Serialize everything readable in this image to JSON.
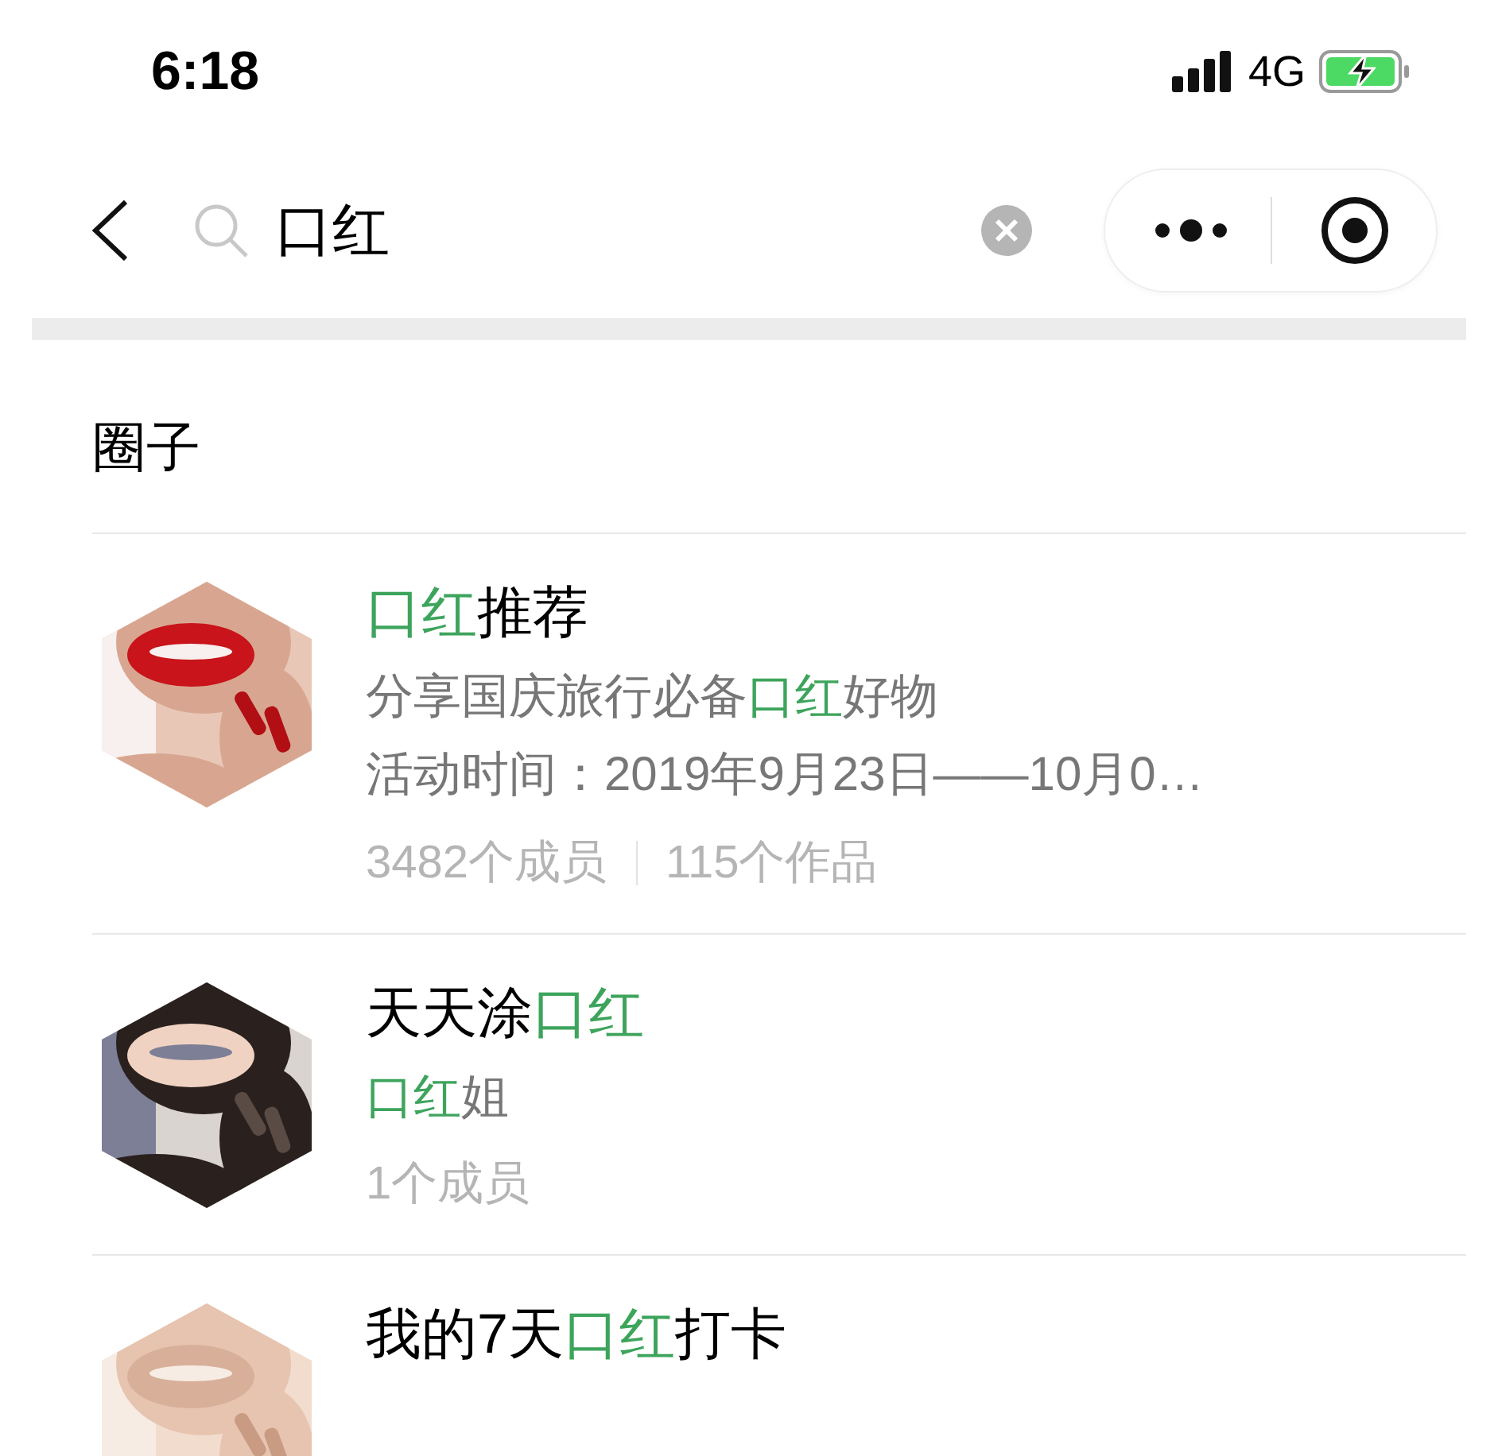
{
  "status_bar": {
    "time": "6:18",
    "network": "4G"
  },
  "search": {
    "value": "口红"
  },
  "section_title": "圈子",
  "groups": [
    {
      "title": [
        {
          "text": "口红",
          "highlight": true
        },
        {
          "text": "推荐",
          "highlight": false
        }
      ],
      "lines": [
        [
          {
            "text": "分享国庆旅行必备",
            "highlight": false
          },
          {
            "text": "口红",
            "highlight": true
          },
          {
            "text": "好物",
            "highlight": false
          }
        ],
        [
          {
            "text": "活动时间：2019年9月23日——10月0…",
            "highlight": false
          }
        ]
      ],
      "stats": [
        "3482个成员",
        "115个作品"
      ],
      "picture": {
        "kind": "picture"
      }
    },
    {
      "title": [
        {
          "text": "天天涂",
          "highlight": false
        },
        {
          "text": "口红",
          "highlight": true
        }
      ],
      "lines": [
        [
          {
            "text": "口红",
            "highlight": true
          },
          {
            "text": "姐",
            "highlight": false
          }
        ]
      ],
      "stats": [
        "1个成员"
      ],
      "picture": {
        "kind": "picture"
      }
    },
    {
      "title": [
        {
          "text": "我的7天",
          "highlight": false
        },
        {
          "text": "口红",
          "highlight": true
        },
        {
          "text": "打卡",
          "highlight": false
        }
      ],
      "picture": {
        "kind": "picture"
      }
    }
  ]
}
